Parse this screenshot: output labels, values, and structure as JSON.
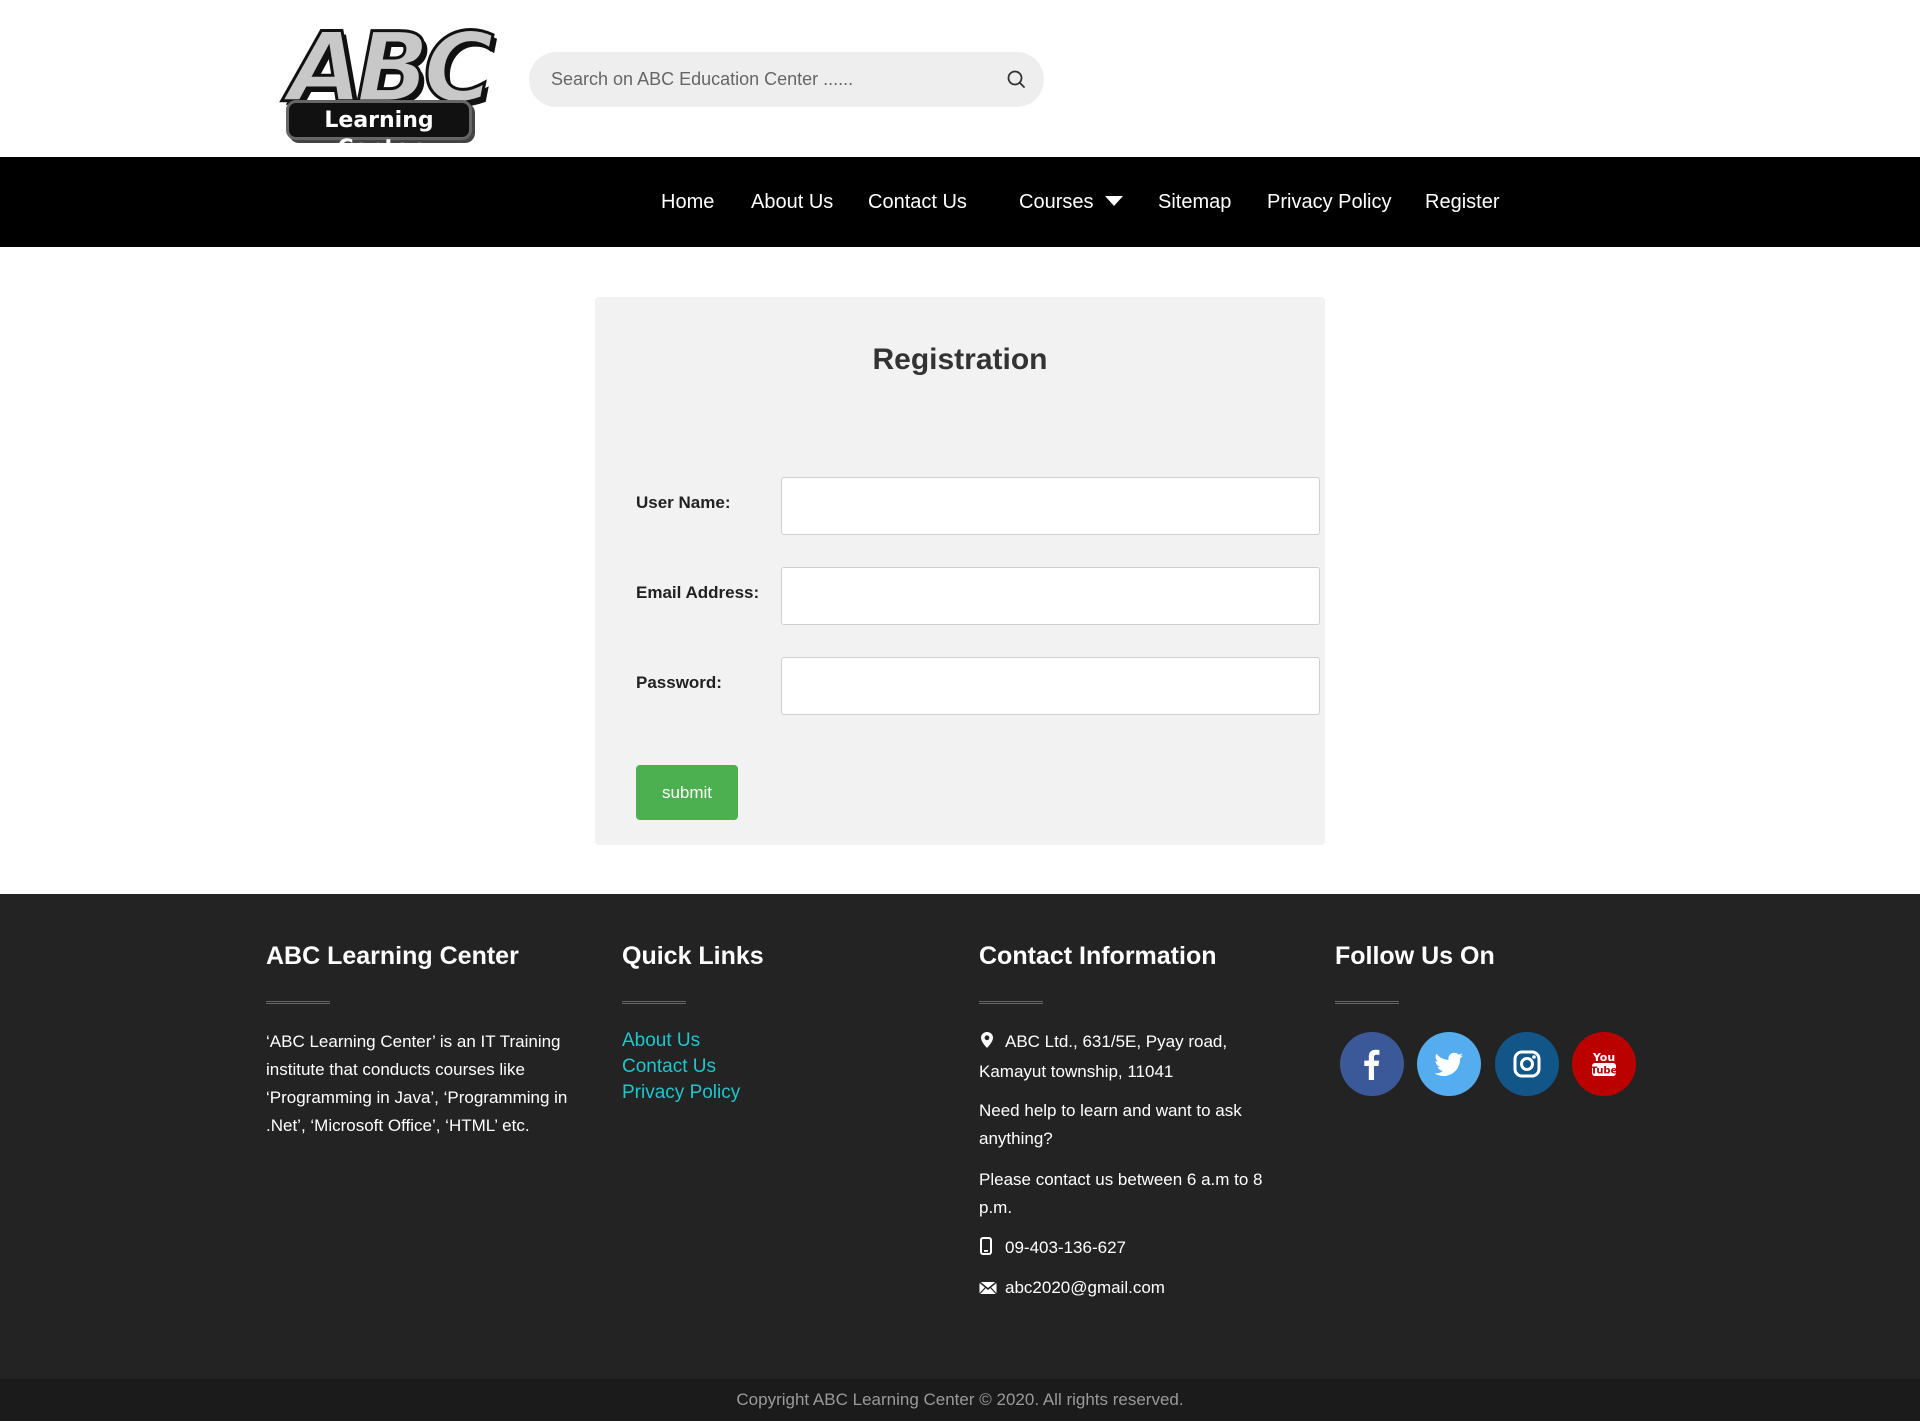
{
  "header": {
    "logo_main": "ABC",
    "logo_sub": "Learning Center",
    "search_placeholder": "Search on ABC Education Center ......"
  },
  "nav": {
    "items": [
      {
        "label": "Home"
      },
      {
        "label": "About Us"
      },
      {
        "label": "Contact Us"
      },
      {
        "label": "Courses",
        "dropdown": true
      },
      {
        "label": "Sitemap"
      },
      {
        "label": "Privacy Policy"
      },
      {
        "label": "Register"
      }
    ]
  },
  "registration": {
    "title": "Registration",
    "username_label": "User Name:",
    "email_label": "Email Address:",
    "password_label": "Password:",
    "username_value": "",
    "email_value": "",
    "password_value": "",
    "submit_label": "submit"
  },
  "footer": {
    "about": {
      "heading": "ABC Learning Center",
      "text": "‘ABC Learning Center’ is an IT Training institute that conducts courses like ‘Programming in Java’, ‘Programming in .Net’, ‘Microsoft Office’, ‘HTML’ etc."
    },
    "quick_links": {
      "heading": "Quick Links",
      "links": [
        "About Us",
        "Contact Us",
        "Privacy Policy"
      ]
    },
    "contact": {
      "heading": "Contact Information",
      "address": "ABC Ltd., 631/5E, Pyay road, Kamayut township, 11041",
      "help": "Need help to learn and want to ask anything?",
      "hours": "Please contact us between 6 a.m to 8 p.m.",
      "phone": "09-403-136-627",
      "email": "abc2020@gmail.com"
    },
    "follow": {
      "heading": "Follow Us On",
      "networks": [
        "facebook-icon",
        "twitter-icon",
        "instagram-icon",
        "youtube-icon"
      ],
      "youtube_text_top": "You",
      "youtube_text_bottom": "Tube"
    },
    "copyright": "Copyright  ABC Learning Center © 2020. All rights reserved."
  },
  "colors": {
    "nav_bg": "#000000",
    "footer_bg": "#232323",
    "link": "#20c5cf",
    "submit": "#4caf50",
    "facebook": "#3b5998",
    "twitter": "#55acee",
    "instagram": "#125688",
    "youtube": "#bb0000"
  }
}
